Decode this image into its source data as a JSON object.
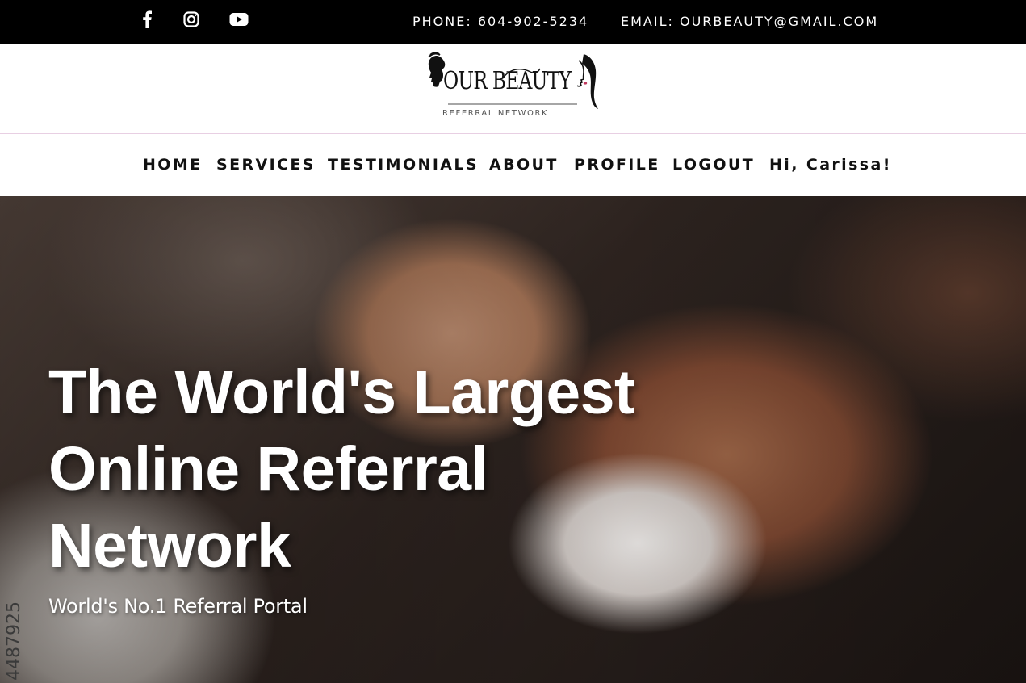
{
  "topbar": {
    "social": [
      {
        "name": "facebook-icon"
      },
      {
        "name": "instagram-icon"
      },
      {
        "name": "youtube-icon"
      }
    ],
    "phone": "PHONE: 604-902-5234",
    "email": "EMAIL: OURBEAUTY@GMAIL.COM"
  },
  "logo": {
    "wordmark": "OUR BEAUTY",
    "subtitle": "REFERRAL NETWORK"
  },
  "nav": {
    "items": [
      {
        "label": "HOME"
      },
      {
        "label": "SERVICES"
      },
      {
        "label": "TESTIMONIALS"
      },
      {
        "label": "ABOUT"
      },
      {
        "label": "PROFILE"
      },
      {
        "label": "LOGOUT"
      },
      {
        "label": "Hi, Carissa!"
      }
    ]
  },
  "hero": {
    "title_lines": [
      "The World's Largest",
      "Online Referral",
      "Network"
    ],
    "subtitle": "World's No.1 Referral Portal",
    "stock_id": "4487925"
  },
  "colors": {
    "topbar_bg": "#000000",
    "nav_text": "#111111",
    "divider": "#e8cfe3"
  }
}
